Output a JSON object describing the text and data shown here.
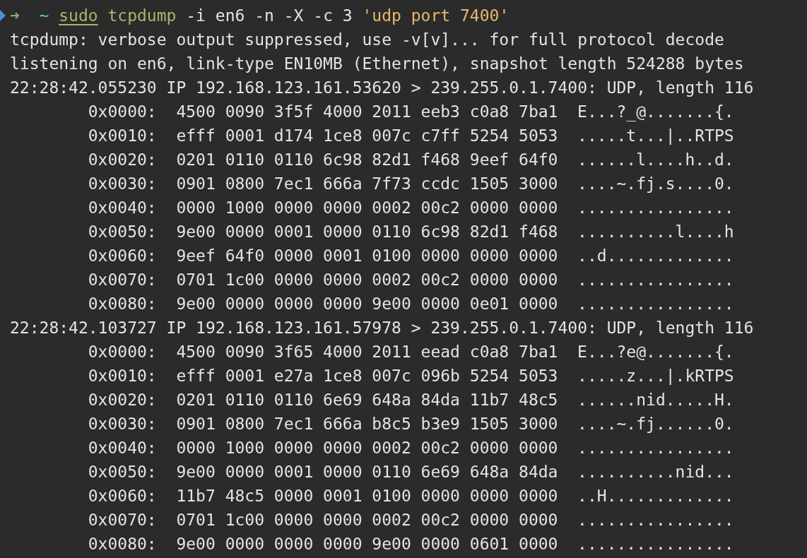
{
  "prompt": {
    "marked": true,
    "arrow": "➜",
    "cwd": "~",
    "command": [
      {
        "kind": "builtin",
        "text": "sudo"
      },
      {
        "kind": "program",
        "text": "tcpdump"
      },
      {
        "kind": "arg",
        "text": "-i en6 -n -X -c 3"
      },
      {
        "kind": "string",
        "text": "'udp port 7400'"
      }
    ]
  },
  "lines": [
    {
      "kind": "message",
      "text": "tcpdump: verbose output suppressed, use -v[v]... for full protocol decode"
    },
    {
      "kind": "message",
      "text": "listening on en6, link-type EN10MB (Ethernet), snapshot length 524288 bytes"
    },
    {
      "kind": "packet",
      "text": "22:28:42.055230 IP 192.168.123.161.53620 > 239.255.0.1.7400: UDP, length 116"
    },
    {
      "kind": "hex",
      "text": "0x0000:  4500 0090 3f5f 4000 2011 eeb3 c0a8 7ba1  E...?_@.......{."
    },
    {
      "kind": "hex",
      "text": "0x0010:  efff 0001 d174 1ce8 007c c7ff 5254 5053  .....t...|..RTPS"
    },
    {
      "kind": "hex",
      "text": "0x0020:  0201 0110 0110 6c98 82d1 f468 9eef 64f0  ......l....h..d."
    },
    {
      "kind": "hex",
      "text": "0x0030:  0901 0800 7ec1 666a 7f73 ccdc 1505 3000  ....~.fj.s....0."
    },
    {
      "kind": "hex",
      "text": "0x0040:  0000 1000 0000 0000 0002 00c2 0000 0000  ................"
    },
    {
      "kind": "hex",
      "text": "0x0050:  9e00 0000 0001 0000 0110 6c98 82d1 f468  ..........l....h"
    },
    {
      "kind": "hex",
      "text": "0x0060:  9eef 64f0 0000 0001 0100 0000 0000 0000  ..d............."
    },
    {
      "kind": "hex",
      "text": "0x0070:  0701 1c00 0000 0000 0002 00c2 0000 0000  ................"
    },
    {
      "kind": "hex",
      "text": "0x0080:  9e00 0000 0000 0000 9e00 0000 0e01 0000  ................"
    },
    {
      "kind": "packet",
      "text": "22:28:42.103727 IP 192.168.123.161.57978 > 239.255.0.1.7400: UDP, length 116"
    },
    {
      "kind": "hex",
      "text": "0x0000:  4500 0090 3f65 4000 2011 eead c0a8 7ba1  E...?e@.......{."
    },
    {
      "kind": "hex",
      "text": "0x0010:  efff 0001 e27a 1ce8 007c 096b 5254 5053  .....z...|.kRTPS"
    },
    {
      "kind": "hex",
      "text": "0x0020:  0201 0110 0110 6e69 648a 84da 11b7 48c5  ......nid.....H."
    },
    {
      "kind": "hex",
      "text": "0x0030:  0901 0800 7ec1 666a b8c5 b3e9 1505 3000  ....~.fj......0."
    },
    {
      "kind": "hex",
      "text": "0x0040:  0000 1000 0000 0000 0002 00c2 0000 0000  ................"
    },
    {
      "kind": "hex",
      "text": "0x0050:  9e00 0000 0001 0000 0110 6e69 648a 84da  ..........nid..."
    },
    {
      "kind": "hex",
      "text": "0x0060:  11b7 48c5 0000 0001 0100 0000 0000 0000  ..H............."
    },
    {
      "kind": "hex",
      "text": "0x0070:  0701 1c00 0000 0000 0002 00c2 0000 0000  ................"
    },
    {
      "kind": "hex",
      "text": "0x0080:  9e00 0000 0000 0000 9e00 0000 0601 0000  ................"
    }
  ]
}
